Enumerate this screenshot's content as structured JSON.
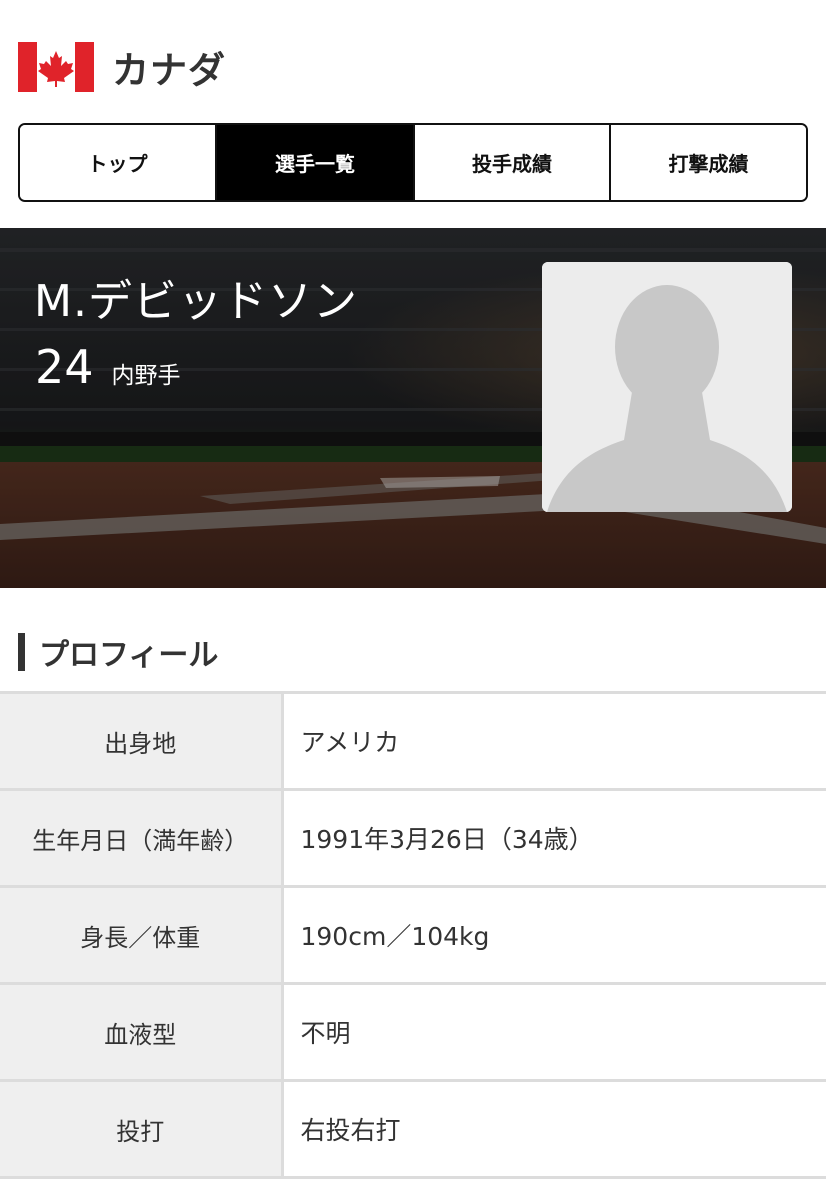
{
  "team": {
    "name": "カナダ",
    "flag_icon": "canada-flag-icon",
    "flag_colors": {
      "red": "#e0232a",
      "white": "#ffffff"
    }
  },
  "tabs": [
    {
      "label": "トップ",
      "active": false
    },
    {
      "label": "選手一覧",
      "active": true
    },
    {
      "label": "投手成績",
      "active": false
    },
    {
      "label": "打撃成績",
      "active": false
    }
  ],
  "player": {
    "name": "M.デビッドソン",
    "number": "24",
    "position": "内野手",
    "photo_icon": "person-silhouette-icon"
  },
  "profile": {
    "section_title": "プロフィール",
    "rows": [
      {
        "label": "出身地",
        "value": "アメリカ"
      },
      {
        "label": "生年月日（満年齢）",
        "value": "1991年3月26日（34歳）"
      },
      {
        "label": "身長／体重",
        "value": "190cm／104kg"
      },
      {
        "label": "血液型",
        "value": "不明"
      },
      {
        "label": "投打",
        "value": "右投右打"
      }
    ]
  },
  "colors": {
    "tab_active_bg": "#000000",
    "tab_border": "#111111",
    "label_cell_bg": "#efefef",
    "photo_bg": "#ececec",
    "photo_silhouette": "#c8c8c8"
  }
}
